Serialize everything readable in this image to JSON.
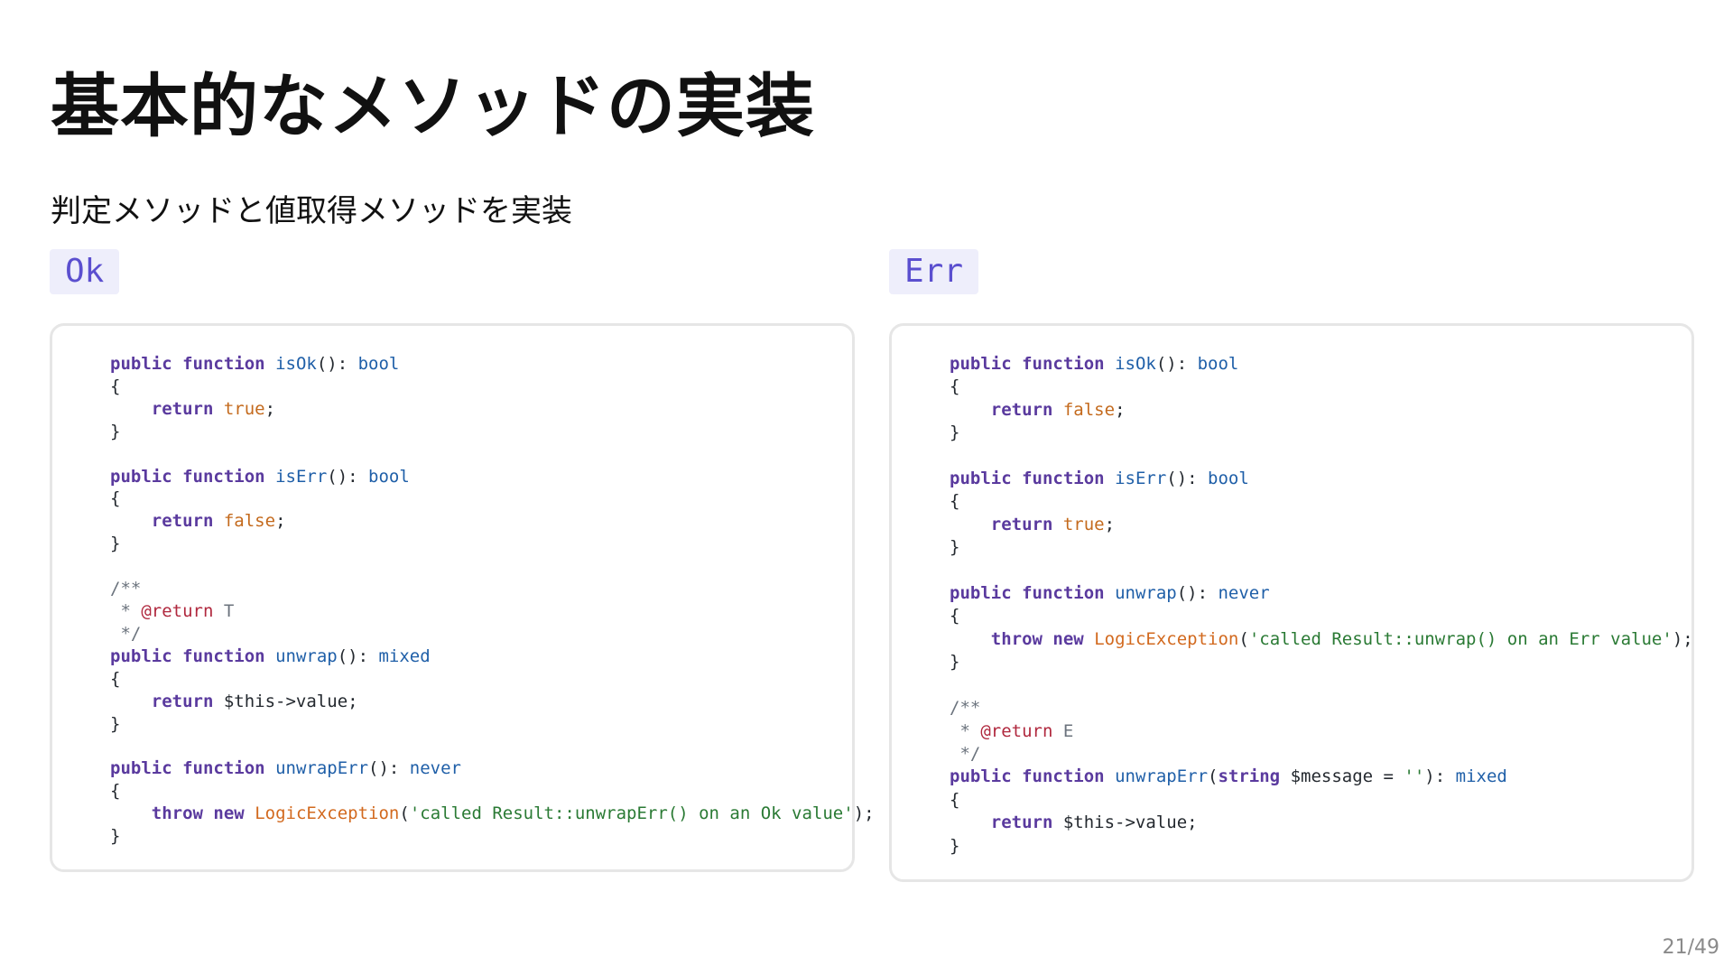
{
  "title": "基本的なメソッドの実装",
  "subtitle": "判定メソッドと値取得メソッドを実装",
  "ok": {
    "label": "Ok",
    "lines": [
      [
        [
          "kw",
          "public"
        ],
        [
          "",
          " "
        ],
        [
          "kw",
          "function"
        ],
        [
          "",
          " "
        ],
        [
          "fn",
          "isOk"
        ],
        [
          "",
          "(): "
        ],
        [
          "ty",
          "bool"
        ]
      ],
      [
        [
          "",
          "{"
        ]
      ],
      [
        [
          "",
          "    "
        ],
        [
          "kw",
          "return"
        ],
        [
          "",
          " "
        ],
        [
          "lit",
          "true"
        ],
        [
          "",
          ";"
        ]
      ],
      [
        [
          "",
          "}"
        ]
      ],
      [],
      [
        [
          "kw",
          "public"
        ],
        [
          "",
          " "
        ],
        [
          "kw",
          "function"
        ],
        [
          "",
          " "
        ],
        [
          "fn",
          "isErr"
        ],
        [
          "",
          "(): "
        ],
        [
          "ty",
          "bool"
        ]
      ],
      [
        [
          "",
          "{"
        ]
      ],
      [
        [
          "",
          "    "
        ],
        [
          "kw",
          "return"
        ],
        [
          "",
          " "
        ],
        [
          "lit",
          "false"
        ],
        [
          "",
          ";"
        ]
      ],
      [
        [
          "",
          "}"
        ]
      ],
      [],
      [
        [
          "cm",
          "/**"
        ]
      ],
      [
        [
          "cm",
          " * "
        ],
        [
          "tag",
          "@return"
        ],
        [
          "cm",
          " T"
        ]
      ],
      [
        [
          "cm",
          " */"
        ]
      ],
      [
        [
          "kw",
          "public"
        ],
        [
          "",
          " "
        ],
        [
          "kw",
          "function"
        ],
        [
          "",
          " "
        ],
        [
          "fn",
          "unwrap"
        ],
        [
          "",
          "(): "
        ],
        [
          "ty",
          "mixed"
        ]
      ],
      [
        [
          "",
          "{"
        ]
      ],
      [
        [
          "",
          "    "
        ],
        [
          "kw",
          "return"
        ],
        [
          "",
          " "
        ],
        [
          "var",
          "$this->value"
        ],
        [
          "",
          ";"
        ]
      ],
      [
        [
          "",
          "}"
        ]
      ],
      [],
      [
        [
          "kw",
          "public"
        ],
        [
          "",
          " "
        ],
        [
          "kw",
          "function"
        ],
        [
          "",
          " "
        ],
        [
          "fn",
          "unwrapErr"
        ],
        [
          "",
          "(): "
        ],
        [
          "ty",
          "never"
        ]
      ],
      [
        [
          "",
          "{"
        ]
      ],
      [
        [
          "",
          "    "
        ],
        [
          "kw",
          "throw"
        ],
        [
          "",
          " "
        ],
        [
          "kw",
          "new"
        ],
        [
          "",
          " "
        ],
        [
          "cls",
          "LogicException"
        ],
        [
          "",
          "("
        ],
        [
          "str",
          "'called Result::unwrapErr() on an Ok value'"
        ],
        [
          "",
          ");"
        ]
      ],
      [
        [
          "",
          "}"
        ]
      ]
    ]
  },
  "err": {
    "label": "Err",
    "lines": [
      [
        [
          "kw",
          "public"
        ],
        [
          "",
          " "
        ],
        [
          "kw",
          "function"
        ],
        [
          "",
          " "
        ],
        [
          "fn",
          "isOk"
        ],
        [
          "",
          "(): "
        ],
        [
          "ty",
          "bool"
        ]
      ],
      [
        [
          "",
          "{"
        ]
      ],
      [
        [
          "",
          "    "
        ],
        [
          "kw",
          "return"
        ],
        [
          "",
          " "
        ],
        [
          "lit",
          "false"
        ],
        [
          "",
          ";"
        ]
      ],
      [
        [
          "",
          "}"
        ]
      ],
      [],
      [
        [
          "kw",
          "public"
        ],
        [
          "",
          " "
        ],
        [
          "kw",
          "function"
        ],
        [
          "",
          " "
        ],
        [
          "fn",
          "isErr"
        ],
        [
          "",
          "(): "
        ],
        [
          "ty",
          "bool"
        ]
      ],
      [
        [
          "",
          "{"
        ]
      ],
      [
        [
          "",
          "    "
        ],
        [
          "kw",
          "return"
        ],
        [
          "",
          " "
        ],
        [
          "lit",
          "true"
        ],
        [
          "",
          ";"
        ]
      ],
      [
        [
          "",
          "}"
        ]
      ],
      [],
      [
        [
          "kw",
          "public"
        ],
        [
          "",
          " "
        ],
        [
          "kw",
          "function"
        ],
        [
          "",
          " "
        ],
        [
          "fn",
          "unwrap"
        ],
        [
          "",
          "(): "
        ],
        [
          "ty",
          "never"
        ]
      ],
      [
        [
          "",
          "{"
        ]
      ],
      [
        [
          "",
          "    "
        ],
        [
          "kw",
          "throw"
        ],
        [
          "",
          " "
        ],
        [
          "kw",
          "new"
        ],
        [
          "",
          " "
        ],
        [
          "cls",
          "LogicException"
        ],
        [
          "",
          "("
        ],
        [
          "str",
          "'called Result::unwrap() on an Err value'"
        ],
        [
          "",
          ");"
        ]
      ],
      [
        [
          "",
          "}"
        ]
      ],
      [],
      [
        [
          "cm",
          "/**"
        ]
      ],
      [
        [
          "cm",
          " * "
        ],
        [
          "tag",
          "@return"
        ],
        [
          "cm",
          " E"
        ]
      ],
      [
        [
          "cm",
          " */"
        ]
      ],
      [
        [
          "kw",
          "public"
        ],
        [
          "",
          " "
        ],
        [
          "kw",
          "function"
        ],
        [
          "",
          " "
        ],
        [
          "fn",
          "unwrapErr"
        ],
        [
          "",
          "("
        ],
        [
          "kw",
          "string"
        ],
        [
          "",
          " "
        ],
        [
          "var",
          "$message"
        ],
        [
          "",
          " = "
        ],
        [
          "str",
          "''"
        ],
        [
          "",
          "): "
        ],
        [
          "ty",
          "mixed"
        ]
      ],
      [
        [
          "",
          "{"
        ]
      ],
      [
        [
          "",
          "    "
        ],
        [
          "kw",
          "return"
        ],
        [
          "",
          " "
        ],
        [
          "var",
          "$this->value"
        ],
        [
          "",
          ";"
        ]
      ],
      [
        [
          "",
          "}"
        ]
      ]
    ]
  },
  "page_number": "21/49"
}
